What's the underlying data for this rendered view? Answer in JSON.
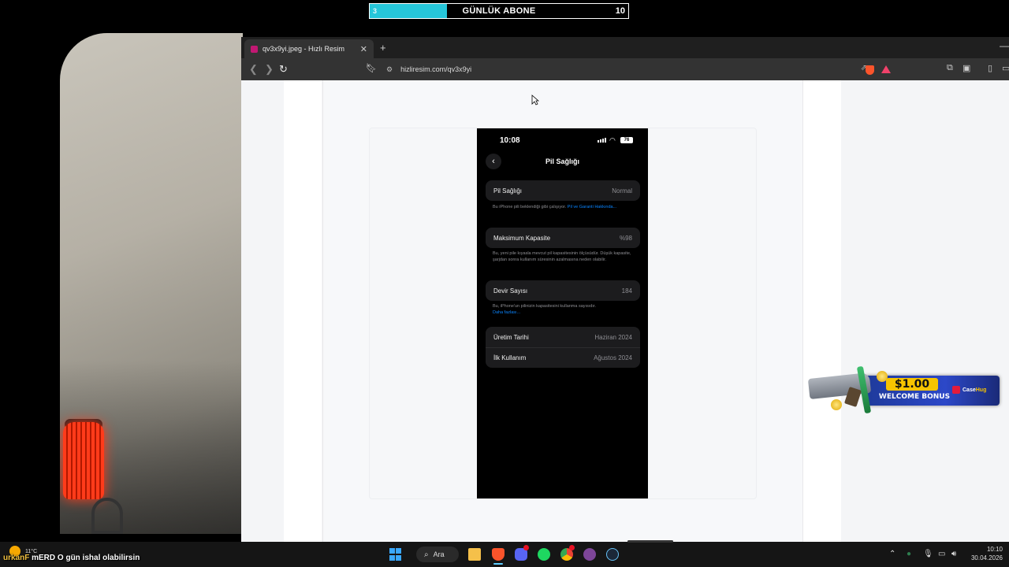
{
  "overlay": {
    "subscriber_goal": {
      "current": "3",
      "title": "GÜNLÜK ABONE",
      "goal": "10",
      "progress": 0.3,
      "color": "#26c6da"
    }
  },
  "chat_overlay": {
    "username": "urkanF",
    "message": "mERD O gün ishal olabilirsin"
  },
  "browser": {
    "tab_title": "qv3x9yi.jpeg - Hızlı Resim",
    "tab_close": "✕",
    "new_tab": "+",
    "minimize": "—",
    "url": "hizliresim.com/qv3x9yi",
    "icons": [
      "back-icon",
      "forward-icon",
      "reload-icon",
      "bookmark-icon",
      "site-settings-icon",
      "share-icon",
      "brave-shield-icon",
      "brave-rewards-icon",
      "extensions-icon",
      "wallet-icon",
      "sidebar-icon"
    ]
  },
  "phone": {
    "time": "10:08",
    "battery": "76",
    "title": "Pil Sağlığı",
    "battery_health": {
      "label": "Pil Sağlığı",
      "value": "Normal",
      "note": "Bu iPhone pili beklendiği gibi çalışıyor.",
      "link": "Pil ve Garanti Hakkında..."
    },
    "max_capacity": {
      "label": "Maksimum Kapasite",
      "value": "%98",
      "note": "Bu, yeni pile kıyasla mevcut pil kapasitesinin ölçüsüdür. Düşük kapasite, şarjdan sonra kullanım süresinin azalmasına neden olabilir."
    },
    "cycle_count": {
      "label": "Devir Sayısı",
      "value": "184",
      "note": "Bu, iPhone'un pilinizin kapasitesini kullanma sayısıdır.",
      "link": "Daha fazlası..."
    },
    "manufacture_date": {
      "label": "Üretim Tarihi",
      "value": "Haziran 2024"
    },
    "first_use": {
      "label": "İlk Kullanım",
      "value": "Ağustos 2024"
    }
  },
  "ad": {
    "amount": "$1.00",
    "text": "WELCOME BONUS",
    "brand_a": "Case",
    "brand_b": "Hug"
  },
  "taskbar": {
    "weather_temp": "11°C",
    "search_label": "Ara",
    "time": "10:10",
    "date": "30.04.2026",
    "apps": [
      "windows-start-icon",
      "search-icon",
      "file-explorer-icon",
      "brave-browser-icon",
      "discord-icon",
      "spotify-icon",
      "chrome-icon",
      "tor-browser-icon",
      "steam-icon"
    ],
    "tray": [
      "chevron-up-icon",
      "network-icon",
      "microphone-icon",
      "display-icon",
      "volume-icon"
    ]
  }
}
